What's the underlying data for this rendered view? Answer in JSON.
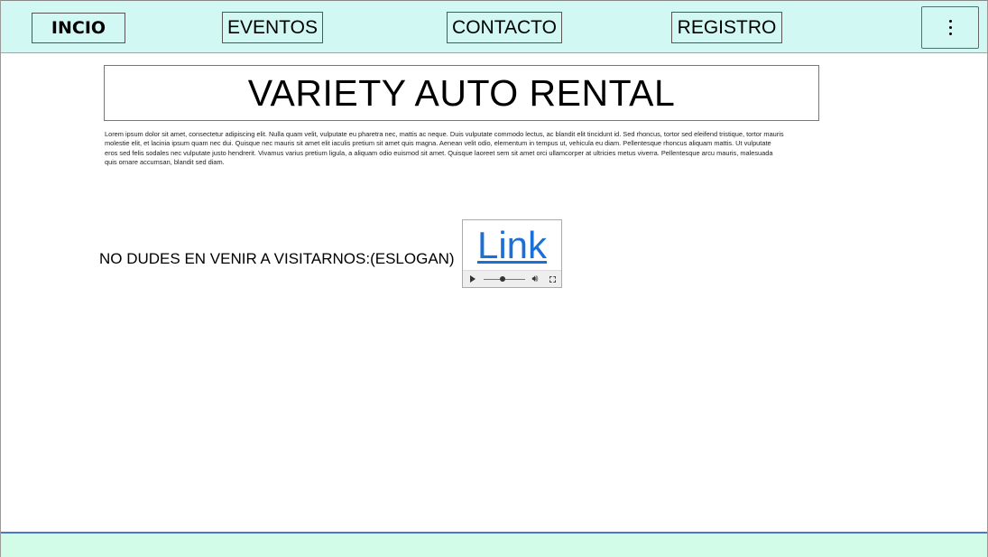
{
  "nav": {
    "inicio": "INCIO",
    "eventos": "EVENTOS",
    "contacto": "CONTACTO",
    "registro": "REGISTRO",
    "menu_icon": "kebab-menu-icon"
  },
  "main": {
    "title": "VARIETY AUTO RENTAL",
    "body_text": "Lorem ipsum dolor sit amet, consectetur adipiscing elit. Nulla quam velit, vulputate eu pharetra nec, mattis ac neque. Duis vulputate commodo lectus, ac blandit elit tincidunt id. Sed rhoncus, tortor sed eleifend tristique, tortor mauris molestie elit, et lacinia ipsum quam nec dui. Quisque nec mauris sit amet elit iaculis pretium sit amet quis magna. Aenean velit odio, elementum in tempus ut, vehicula eu diam. Pellentesque rhoncus aliquam mattis. Ut vulputate eros sed felis sodales nec vulputate justo hendrerit. Vivamus varius pretium ligula, a aliquam odio euismod sit amet. Quisque laoreet sem sit amet orci ullamcorper at ultricies metus viverra. Pellentesque arcu mauris, malesuada quis ornare accumsan, blandit sed diam.",
    "slogan": "NO DUDES EN VENIR A VISITARNOS:(ESLOGAN)",
    "media_link": "Link"
  },
  "colors": {
    "nav_bg": "#d2f8f4",
    "footer_bg": "#d2fbe8",
    "footer_border": "#4a78c8",
    "link": "#1a6fd8"
  }
}
